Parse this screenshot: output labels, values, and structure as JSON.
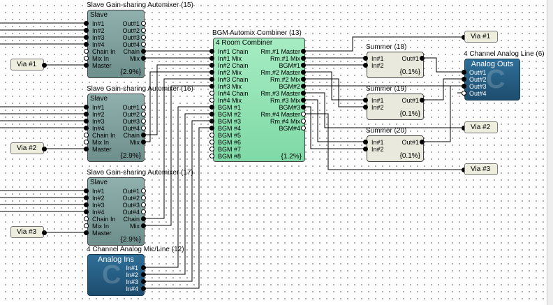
{
  "slaves": [
    {
      "title": "Slave Gain-sharing Automixer (15)",
      "header": "Slave",
      "pct": "{2.9%}",
      "left": [
        "In#1",
        "In#2",
        "In#3",
        "In#4",
        "Chain In",
        "Mix In",
        "Master"
      ],
      "right": [
        "Out#1",
        "Out#2",
        "Out#3",
        "Out#4",
        "Chain",
        "Mix"
      ]
    },
    {
      "title": "Slave Gain-sharing Automixer (16)",
      "header": "Slave",
      "pct": "{2.9%}",
      "left": [
        "In#1",
        "In#2",
        "In#3",
        "In#4",
        "Chain In",
        "Mix In",
        "Master"
      ],
      "right": [
        "Out#1",
        "Out#2",
        "Out#3",
        "Out#4",
        "Chain",
        "Mix"
      ]
    },
    {
      "title": "Slave Gain-sharing Automixer (17)",
      "header": "Slave",
      "pct": "{2.9%}",
      "left": [
        "In#1",
        "In#2",
        "In#3",
        "In#4",
        "Chain In",
        "Mix In",
        "Master"
      ],
      "right": [
        "Out#1",
        "Out#2",
        "Out#3",
        "Out#4",
        "Chain",
        "Mix"
      ]
    }
  ],
  "combiner": {
    "title": "BGM Automix Combiner (13)",
    "header": "4 Room Combiner",
    "pct": "{1.2%}",
    "left": [
      "In#1 Chain",
      "In#1 Mix",
      "In#2 Chain",
      "In#2 Mix",
      "In#3 Chain",
      "In#3 Mix",
      "In#4 Chain",
      "In#4 Mix",
      "BGM #1",
      "BGM #2",
      "BGM #3",
      "BGM #4",
      "BGM #5",
      "BGM #6",
      "BGM #7",
      "BGM #8"
    ],
    "right": [
      "Rm.#1 Master",
      "Rm.#1 Mix",
      "BGM#1",
      "Rm.#2 Master",
      "Rm.#2 Mix",
      "BGM#2",
      "Rm.#3 Master",
      "Rm.#3 Mix",
      "BGM#3",
      "Rm.#4 Master",
      "Rm.#4 Mix",
      "BGM#4"
    ]
  },
  "summers": [
    {
      "title": "Summer (18)",
      "left": [
        "In#1",
        "In#2"
      ],
      "right": "Out#1",
      "pct": "{0.1%}"
    },
    {
      "title": "Summer (19)",
      "left": [
        "In#1",
        "In#2"
      ],
      "right": "Out#1",
      "pct": "{0.1%}"
    },
    {
      "title": "Summer (20)",
      "left": [
        "In#1",
        "In#2"
      ],
      "right": "Out#1",
      "pct": "{0.1%}"
    }
  ],
  "analog_out": {
    "title": "4 Channel Analog Line (6)",
    "header": "Analog Outs",
    "ports": [
      "Out#1",
      "Out#2",
      "Out#3",
      "Out#4"
    ]
  },
  "analog_in": {
    "title": "4 Channel Analog Mic/Line (12)",
    "header": "Analog Ins",
    "ports": [
      "In#1",
      "In#2",
      "In#3",
      "In#4"
    ]
  },
  "vias": [
    "Via #1",
    "Via #2",
    "Via #3",
    "Via #1",
    "Via #2",
    "Via #3"
  ],
  "colors": {
    "slave": "#7a9b98",
    "combiner": "#8fe0b3",
    "summer": "#e9e9dd",
    "analog": "#245a80"
  }
}
